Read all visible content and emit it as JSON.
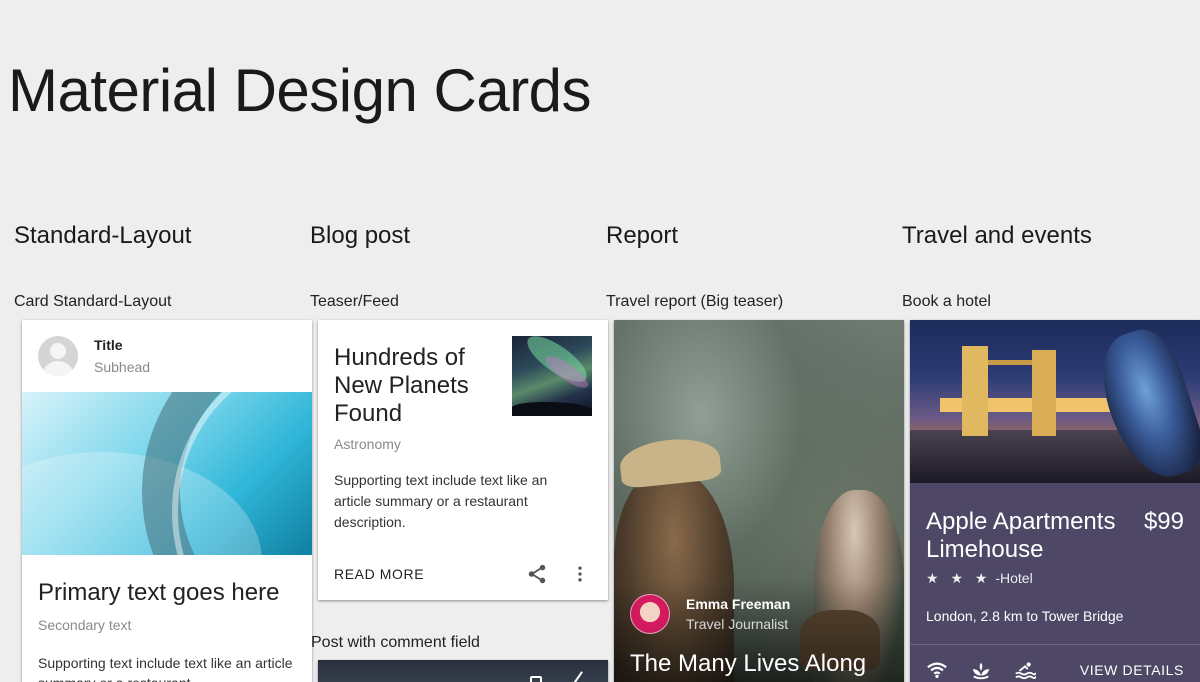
{
  "page": {
    "title": "Material Design Cards"
  },
  "columns": [
    {
      "title": "Standard-Layout",
      "subtitle": "Card Standard-Layout"
    },
    {
      "title": "Blog post",
      "subtitle": "Teaser/Feed"
    },
    {
      "title": "Report",
      "subtitle": "Travel report (Big teaser)"
    },
    {
      "title": "Travel and events",
      "subtitle": "Book a hotel"
    }
  ],
  "standard_card": {
    "title": "Title",
    "subhead": "Subhead",
    "primary_text": "Primary text goes here",
    "secondary_text": "Secondary text",
    "supporting_text": "Supporting text include text like an article summary or a restaurant"
  },
  "blog_card": {
    "title": "Hundreds of New Planets Found",
    "category": "Astronomy",
    "supporting_text": "Supporting text include text like an article summary or a restaurant description.",
    "action_label": "READ MORE",
    "icons": [
      "share-icon",
      "more-vert-icon"
    ]
  },
  "post_comment": {
    "label": "Post with comment field"
  },
  "report_card": {
    "author_name": "Emma Freeman",
    "author_role": "Travel Journalist",
    "headline": "The Many Lives Along"
  },
  "travel_card": {
    "name": "Apple Apartments Limehouse",
    "price": "$99",
    "stars": "★ ★ ★",
    "type": "-Hotel",
    "location": "London, 2.8 km to Tower Bridge",
    "icons": [
      "wifi-icon",
      "spa-icon",
      "pool-icon"
    ],
    "action_label": "VIEW DETAILS"
  }
}
